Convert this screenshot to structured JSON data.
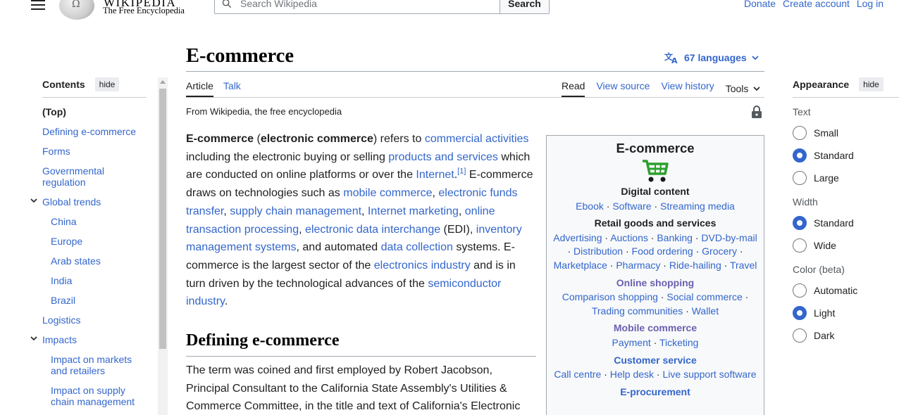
{
  "header": {
    "logo_word": "WIKIPEDIA",
    "logo_tagline": "The Free Encyclopedia",
    "search_placeholder": "Search Wikipedia",
    "search_button": "Search",
    "links": [
      "Donate",
      "Create account",
      "Log in"
    ]
  },
  "toc": {
    "title": "Contents",
    "hide": "hide",
    "items": [
      {
        "label": "(Top)",
        "level": 0,
        "top": true
      },
      {
        "label": "Defining e-commerce",
        "level": 0
      },
      {
        "label": "Forms",
        "level": 0
      },
      {
        "label": "Governmental regulation",
        "level": 0
      },
      {
        "label": "Global trends",
        "level": 0,
        "expandable": true
      },
      {
        "label": "China",
        "level": 1
      },
      {
        "label": "Europe",
        "level": 1
      },
      {
        "label": "Arab states",
        "level": 1
      },
      {
        "label": "India",
        "level": 1
      },
      {
        "label": "Brazil",
        "level": 1
      },
      {
        "label": "Logistics",
        "level": 0
      },
      {
        "label": "Impacts",
        "level": 0,
        "expandable": true
      },
      {
        "label": "Impact on markets and retailers",
        "level": 1
      },
      {
        "label": "Impact on supply chain management",
        "level": 1
      }
    ]
  },
  "page": {
    "title": "E-commerce",
    "languages": "67 languages",
    "tabs_left": [
      "Article",
      "Talk"
    ],
    "tabs_right": [
      "Read",
      "View source",
      "View history"
    ],
    "tools": "Tools",
    "from": "From Wikipedia, the free encyclopedia",
    "section_heading": "Defining e-commerce",
    "section_text": "The term was coined and first employed by Robert Jacobson, Principal Consultant to the California State Assembly's Utilities & Commerce Committee, in the title and text of California's Electronic"
  },
  "lead": {
    "b1": "E-commerce",
    "t1": " (",
    "b2": "electronic commerce",
    "t2": ") refers to ",
    "l1": "commercial activities",
    "t3": " including the electronic buying or selling ",
    "l2": "products and services",
    "t4": " which are conducted on online platforms or over the ",
    "l3": "Internet",
    "t5": ".",
    "ref1": "[1]",
    "t6": " E-commerce draws on technologies such as ",
    "l4": "mobile commerce",
    "t7": ", ",
    "l5": "electronic funds transfer",
    "t8": ", ",
    "l6": "supply chain management",
    "t9": ", ",
    "l7": "Internet marketing",
    "t10": ", ",
    "l8": "online transaction processing",
    "t11": ", ",
    "l9": "electronic data interchange",
    "t12": " (EDI), ",
    "l10": "inventory management systems",
    "t13": ", and automated ",
    "l11": "data collection",
    "t14": " systems. E-commerce is the largest sector of the ",
    "l12": "electronics industry",
    "t15": " and is in turn driven by the technological advances of the ",
    "l13": "semiconductor industry",
    "t16": "."
  },
  "infobox": {
    "title": "E-commerce",
    "sections": [
      {
        "heading": "Digital content",
        "style": "plain",
        "items": [
          "Ebook",
          "Software",
          "Streaming media"
        ]
      },
      {
        "heading": "Retail goods and services",
        "style": "plain",
        "items": [
          "Advertising",
          "Auctions",
          "Banking",
          "DVD-by-mail",
          "Distribution",
          "Food ordering",
          "Grocery",
          "Marketplace",
          "Pharmacy",
          "Ride-hailing",
          "Travel"
        ]
      },
      {
        "heading": "Online shopping",
        "style": "violet",
        "items": [
          "Comparison shopping",
          "Social commerce",
          "Trading communities",
          "Wallet"
        ]
      },
      {
        "heading": "Mobile commerce",
        "style": "violet",
        "items": [
          "Payment",
          "Ticketing"
        ]
      },
      {
        "heading": "Customer service",
        "style": "blue",
        "items": [
          "Call centre",
          "Help desk",
          "Live support software"
        ]
      },
      {
        "heading": "E-procurement",
        "style": "blue",
        "items": []
      }
    ]
  },
  "appearance": {
    "title": "Appearance",
    "hide": "hide",
    "text_label": "Text",
    "text_options": [
      "Small",
      "Standard",
      "Large"
    ],
    "text_selected": "Standard",
    "width_label": "Width",
    "width_options": [
      "Standard",
      "Wide"
    ],
    "width_selected": "Standard",
    "color_label": "Color (beta)",
    "color_options": [
      "Automatic",
      "Light",
      "Dark"
    ],
    "color_selected": "Light"
  },
  "colors": {
    "link": "#3366cc",
    "visited": "#6a60b0",
    "text": "#202122",
    "cart": "#2ca02c"
  }
}
